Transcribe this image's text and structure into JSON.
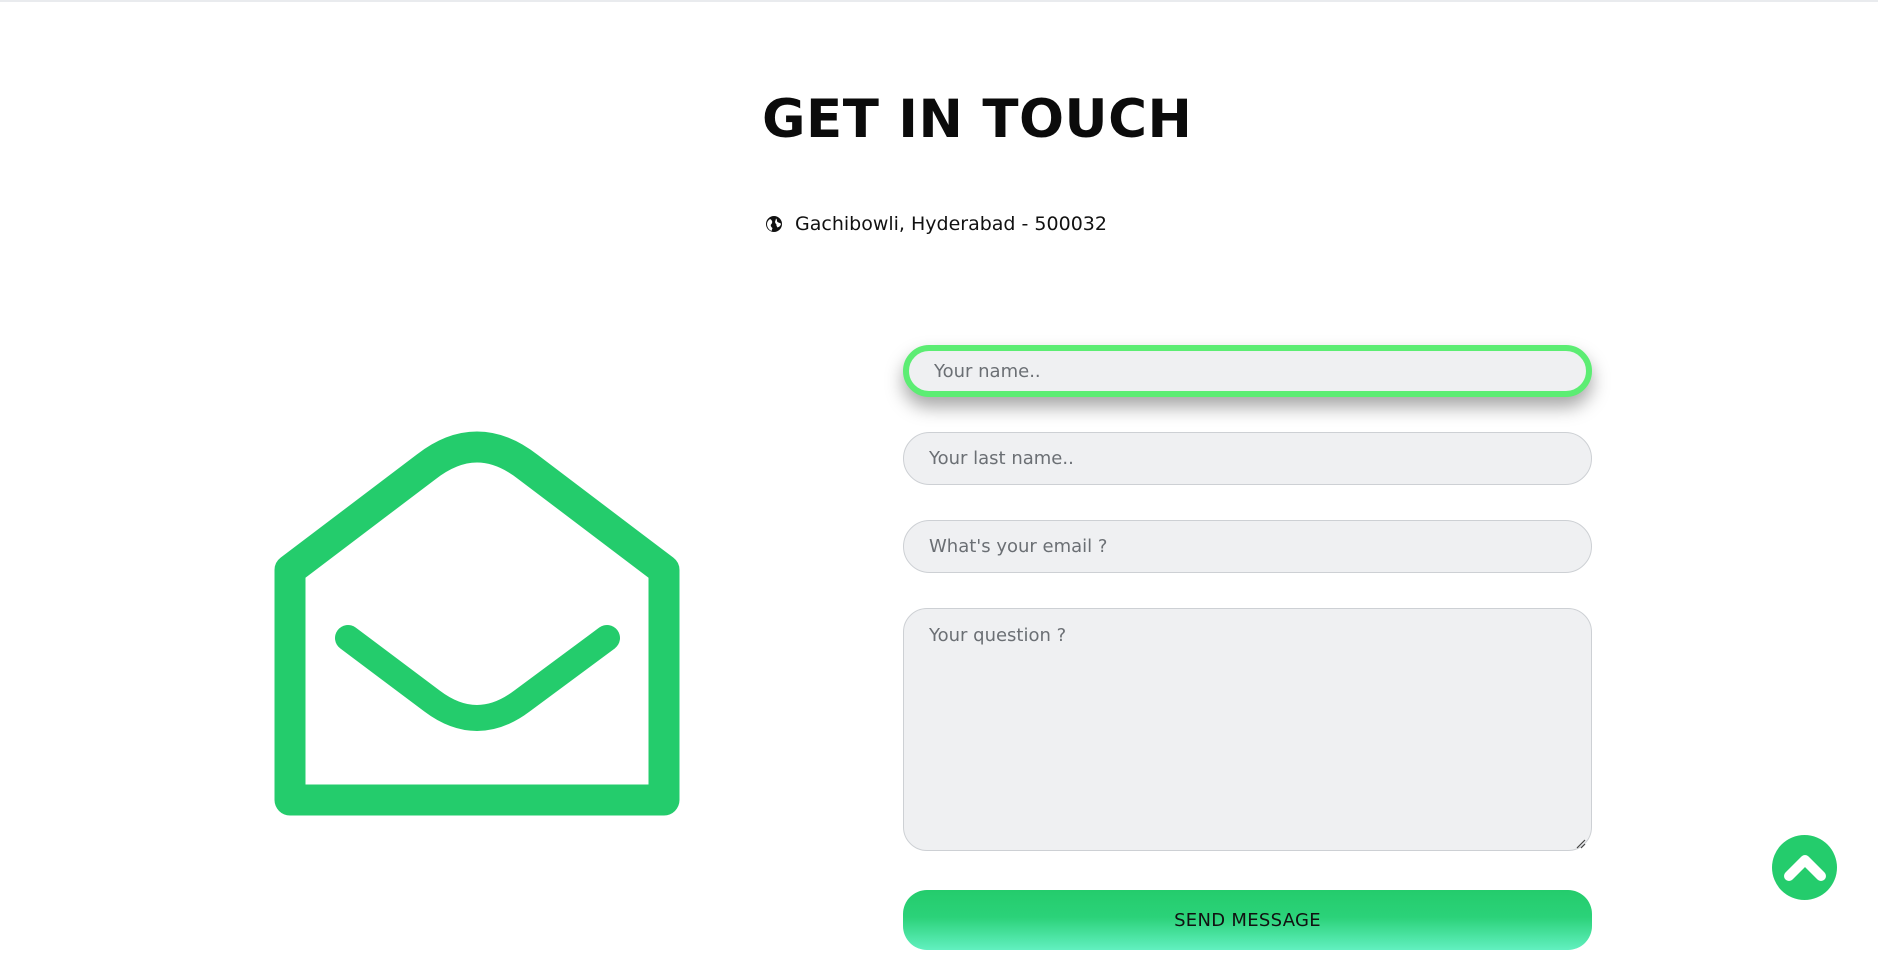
{
  "section": {
    "title": "GET IN TOUCH",
    "address": "Gachibowli, Hyderabad - 500032"
  },
  "form": {
    "name_placeholder": "Your name..",
    "lastname_placeholder": "Your last name..",
    "email_placeholder": "What's your email ?",
    "question_placeholder": "Your question ?",
    "send_label": "SEND MESSAGE"
  },
  "icons": {
    "address": "globe-icon",
    "illustration": "envelope-open-icon",
    "scroll_top": "chevron-up-icon"
  },
  "colors": {
    "accent": "#24cc6c",
    "focus_ring": "#5ced73",
    "field_background": "#eff0f2",
    "button_gradient_end": "#62f0c0"
  }
}
